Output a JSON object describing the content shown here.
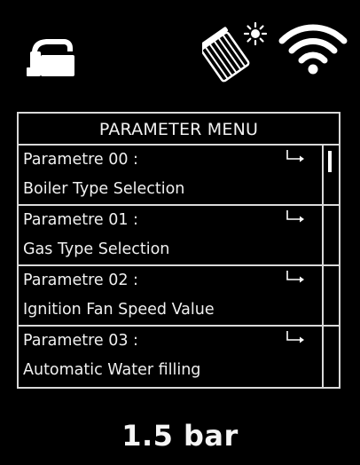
{
  "status_bar": {
    "icons": [
      "tap-icon",
      "radiator-sun-icon",
      "wifi-icon"
    ]
  },
  "menu": {
    "title": "PARAMETER MENU",
    "items": [
      {
        "line1": "Parametre 00 :",
        "line2": "Boiler Type Selection",
        "icon": "arrow-right-icon"
      },
      {
        "line1": "Parametre 01 :",
        "line2": "Gas Type Selection",
        "icon": "arrow-right-icon"
      },
      {
        "line1": "Parametre 02 :",
        "line2": "Ignition Fan Speed Value",
        "icon": "arrow-right-icon"
      },
      {
        "line1": "Parametre 03 :",
        "line2": "Automatic Water filling",
        "icon": "arrow-right-icon"
      }
    ],
    "scroll_position": 0
  },
  "pressure": {
    "value": "1.5 bar"
  },
  "colors": {
    "background": "#000000",
    "foreground": "#ffffff",
    "border": "#d9d9d9"
  }
}
